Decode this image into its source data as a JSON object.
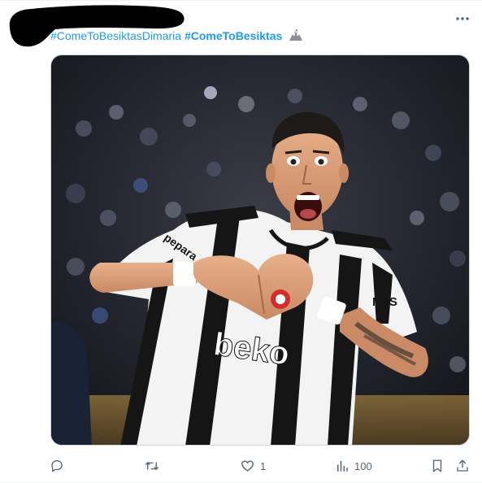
{
  "tweet": {
    "hashtags": [
      "#ComeToBesiktasDimaria",
      "#ComeToBesiktas"
    ],
    "emoji": "eagle-emoji",
    "media": {
      "kind": "photo",
      "sponsor_text": "beko",
      "sleeve_text": "pepara",
      "side_text": "NES"
    },
    "actions": {
      "reply": {
        "icon": "reply-icon",
        "count": ""
      },
      "retweet": {
        "icon": "retweet-icon",
        "count": ""
      },
      "like": {
        "icon": "heart-icon",
        "count": "1"
      },
      "views": {
        "icon": "views-icon",
        "count": "100"
      },
      "bookmark": {
        "icon": "bookmark-icon"
      },
      "share": {
        "icon": "share-icon"
      }
    }
  },
  "colors": {
    "hashtag": "#1d9bf0",
    "action_gray": "#536471",
    "kit_black": "#151515",
    "kit_white": "#f3f3f3"
  }
}
